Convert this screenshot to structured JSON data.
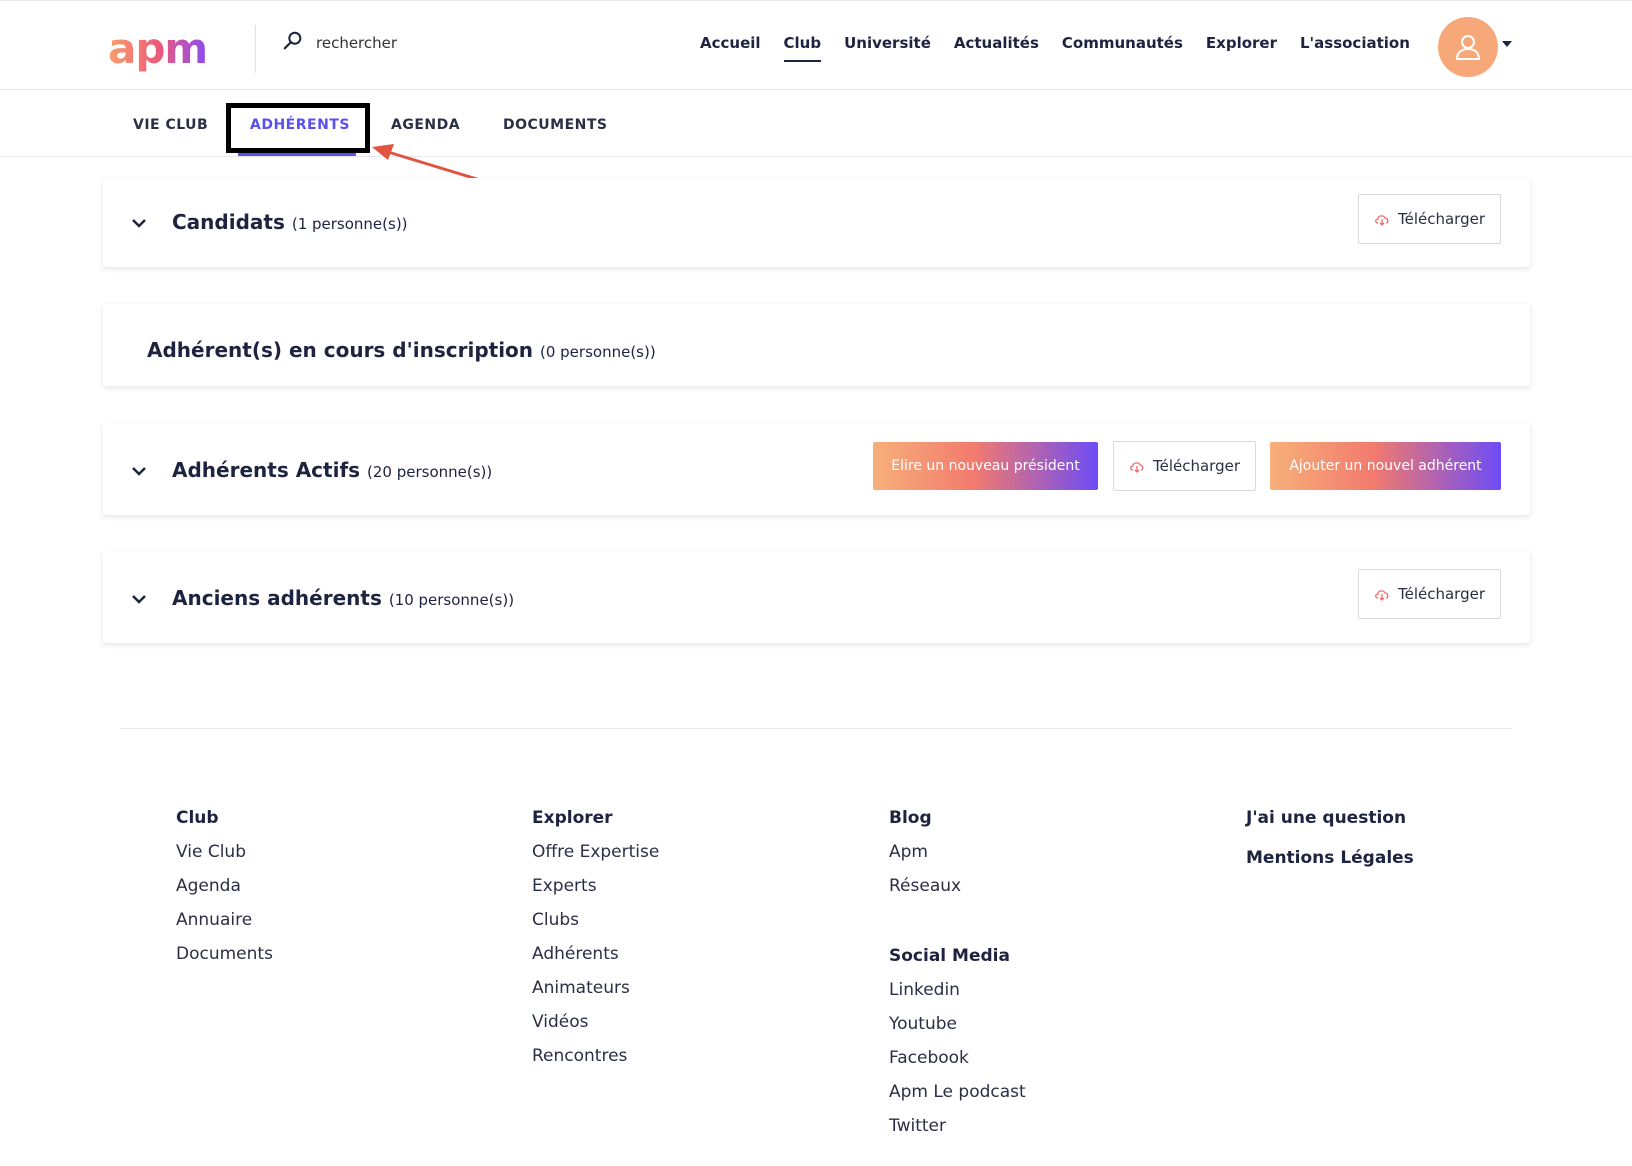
{
  "header": {
    "logo_text": "apm",
    "search_placeholder": "rechercher",
    "nav": [
      "Accueil",
      "Club",
      "Université",
      "Actualités",
      "Communautés",
      "Explorer",
      "L'association"
    ],
    "active_nav": "Club"
  },
  "subnav": {
    "tabs": [
      "VIE CLUB",
      "ADHÉRENTS",
      "AGENDA",
      "DOCUMENTS"
    ],
    "active_tab": "ADHÉRENTS"
  },
  "sections": {
    "candidats": {
      "title": "Candidats",
      "count": "(1 personne(s))",
      "download": "Télécharger"
    },
    "en_cours": {
      "title": "Adhérent(s) en cours d'inscription",
      "count": "(0 personne(s))"
    },
    "actifs": {
      "title": "Adhérents Actifs",
      "count": "(20 personne(s))",
      "elect": "Elire un nouveau président",
      "download": "Télécharger",
      "add": "Ajouter un nouvel adhérent"
    },
    "anciens": {
      "title": "Anciens adhérents",
      "count": "(10 personne(s))",
      "download": "Télécharger"
    }
  },
  "footer": {
    "club": {
      "heading": "Club",
      "items": [
        "Vie Club",
        "Agenda",
        "Annuaire",
        "Documents"
      ]
    },
    "explorer": {
      "heading": "Explorer",
      "items": [
        "Offre Expertise",
        "Experts",
        "Clubs",
        "Adhérents",
        "Animateurs",
        "Vidéos",
        "Rencontres"
      ]
    },
    "blog": {
      "heading": "Blog",
      "items": [
        "Apm",
        "Réseaux"
      ]
    },
    "social": {
      "heading": "Social Media",
      "items": [
        "Linkedin",
        "Youtube",
        "Facebook",
        "Apm Le podcast",
        "Twitter"
      ]
    },
    "links": {
      "question": "J'ai une question",
      "legal": "Mentions Légales"
    }
  },
  "colors": {
    "accent": "#5b4ff0",
    "avatar": "#f7a878",
    "annotation_arrow": "#e0553f"
  }
}
